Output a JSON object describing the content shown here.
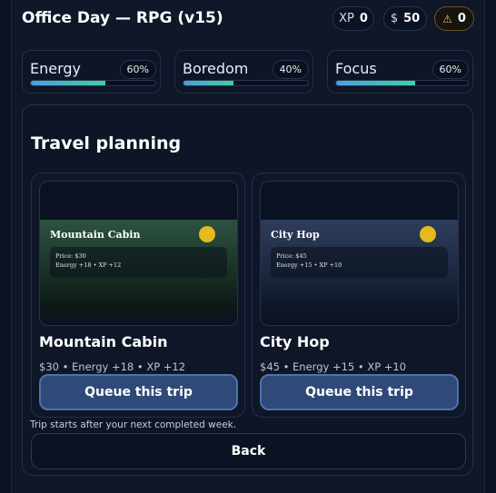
{
  "header": {
    "title": "Office Day — RPG (v15)",
    "xp_label": "XP",
    "xp_value": "0",
    "money_label": "$",
    "money_value": "50",
    "warn_icon": "⚠",
    "warn_value": "0"
  },
  "stats": [
    {
      "label": "Energy",
      "percent_text": "60%",
      "level": 0.6
    },
    {
      "label": "Boredom",
      "percent_text": "40%",
      "level": 0.4
    },
    {
      "label": "Focus",
      "percent_text": "60%",
      "level": 0.6
    }
  ],
  "colors": {
    "bar_start": "#4a9fe0",
    "bar_end": "#3fd1a0",
    "button_bg": "#2f4a78",
    "sun": "#e6b91d"
  },
  "panel": {
    "title": "Travel planning",
    "trips": [
      {
        "scene_name": "Mountain Cabin",
        "info_price": "Price: $30",
        "info_effects": "Energy +18 • XP +12",
        "name": "Mountain Cabin",
        "meta": "$30 • Energy +18 • XP +12",
        "button": "Queue this trip"
      },
      {
        "scene_name": "City Hop",
        "info_price": "Price: $45",
        "info_effects": "Energy +15 • XP +10",
        "name": "City Hop",
        "meta": "$45 • Energy +15 • XP +10",
        "button": "Queue this trip"
      }
    ],
    "note": "Trip starts after your next completed week.",
    "back_label": "Back"
  }
}
